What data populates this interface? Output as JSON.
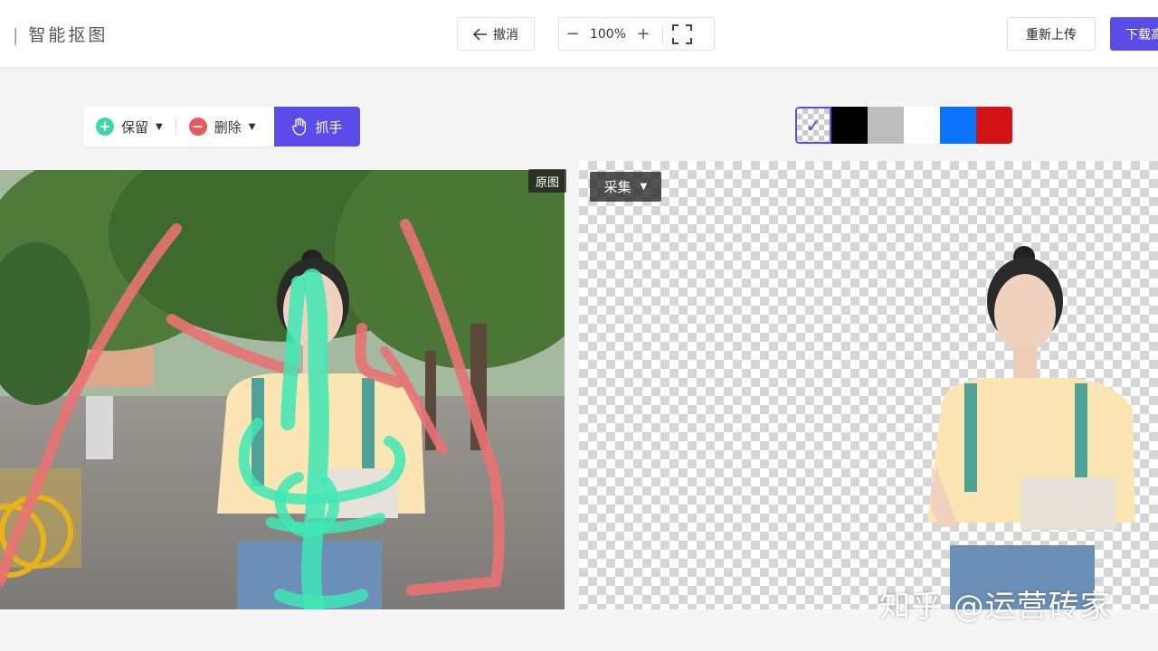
{
  "header": {
    "title": "智能抠图",
    "undo_label": "撤消",
    "zoom_minus": "−",
    "zoom_value": "100%",
    "zoom_plus": "+",
    "reupload_label": "重新上传",
    "download_label": "下载高"
  },
  "tools": {
    "keep_label": "保留",
    "delete_label": "删除",
    "grab_label": "抓手",
    "keep_color": "#3ed8a8",
    "delete_color": "#e85a5a"
  },
  "swatches": [
    "checker",
    "#000000",
    "#bdbdbd",
    "#ffffff",
    "#0a73ff",
    "#d11313"
  ],
  "canvas": {
    "origin_badge": "原图",
    "collect_label": "采集"
  },
  "watermark": "知乎 @运营砖家",
  "colors": {
    "accent": "#5b4be8",
    "keep_stroke": "#3ee8b4",
    "delete_stroke": "#e87272"
  }
}
